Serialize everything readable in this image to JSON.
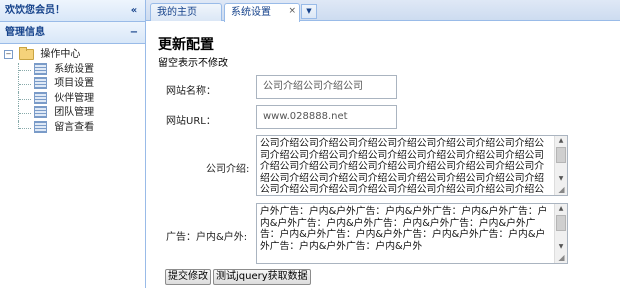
{
  "left_panel": {
    "welcome": "欢饮您会员！",
    "collapse_icon": "«",
    "nav_title": "管理信息",
    "nav_toggle_icon": "−",
    "tree": {
      "root_label": "操作中心",
      "items": [
        "系统设置",
        "项目设置",
        "伙伴管理",
        "团队管理",
        "留言查看"
      ]
    }
  },
  "tabs": {
    "items": [
      {
        "label": "我的主页"
      },
      {
        "label": "系统设置",
        "close": "×"
      }
    ],
    "menu_icon": "▼"
  },
  "form": {
    "title": "更新配置",
    "subtitle": "留空表示不修改",
    "site_name_label": "网站名称：",
    "site_name_value": "公司介绍公司介绍公司",
    "site_url_label": "网站URL：",
    "site_url_value": "www.028888.net",
    "intro_label": "公司介绍:",
    "intro_value": "公司介绍公司介绍公司介绍公司介绍公司介绍公司介绍公司介绍公司介绍公司介绍公司介绍公司介绍公司介绍公司介绍公司介绍公司介绍公司介绍公司介绍公司介绍公司介绍公司介绍公司介绍公司介绍公司介绍公司介绍公司介绍公司介绍公司介绍公司介绍公司介绍公司介绍公司介绍公司介绍公司介绍公司介绍公司介绍公司介绍公司介绍",
    "ad_label": "广告：户内&户外:",
    "ad_value": "户外广告：户内&户外广告：户内&户外广告：户内&户外广告：户内&户外广告：户内&户外广告：户内&户外广告：户内&户外广告：户内&户外广告：户内&户外广告：户内&户外广告：户内&户外广告：户内&户外广告：户内&户外",
    "submit_label": "提交修改",
    "jquery_button_label": "测试jquery获取数据"
  }
}
